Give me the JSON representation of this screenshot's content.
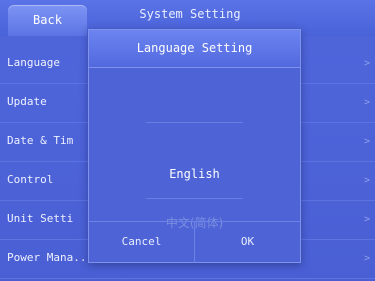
{
  "header": {
    "back_label": "Back",
    "title": "System Setting"
  },
  "menu": {
    "items": [
      {
        "label": "Language"
      },
      {
        "label": "Update"
      },
      {
        "label": "Date & Tim"
      },
      {
        "label": "Control"
      },
      {
        "label": "Unit Setti"
      },
      {
        "label": "Power Mana..."
      }
    ],
    "chevron": ">"
  },
  "dialog": {
    "title": "Language Setting",
    "options": [
      "English",
      "中文(简体)"
    ],
    "selected": "English",
    "cancel_label": "Cancel",
    "ok_label": "OK"
  },
  "colors": {
    "background": "#4a5fd6",
    "dialog": "#4d63d6",
    "header": "#5a73e6"
  }
}
